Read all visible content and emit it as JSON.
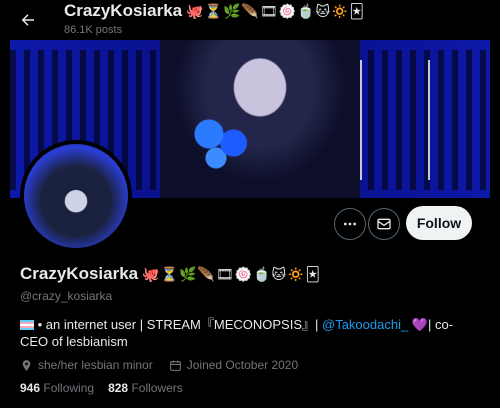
{
  "header": {
    "name": "CrazyKosiarka",
    "emojis": "🐙⏳🌿🪶🎞🍥🍵🐱🔅🃏",
    "post_count": "86.1K posts",
    "back_icon": "arrow-left-icon"
  },
  "profile": {
    "display_name": "CrazyKosiarka",
    "emojis": "🐙⏳🌿🪶🎞🍥🍵🐱🔅🃏",
    "handle": "@crazy_kosiarka",
    "bio": {
      "prefix": " • an internet user | STREAM『MECONOPSIS』| ",
      "mention": "@Takoodachi_",
      "heart": " 💜",
      "suffix": "| co-CEO of lesbianism"
    },
    "pronouns": "she/her lesbian minor",
    "joined": "Joined October 2020",
    "following_count": "946",
    "following_label": "Following",
    "followers_count": "828",
    "followers_label": "Followers"
  },
  "actions": {
    "more_icon": "more-icon",
    "message_icon": "mail-icon",
    "follow_label": "Follow"
  }
}
